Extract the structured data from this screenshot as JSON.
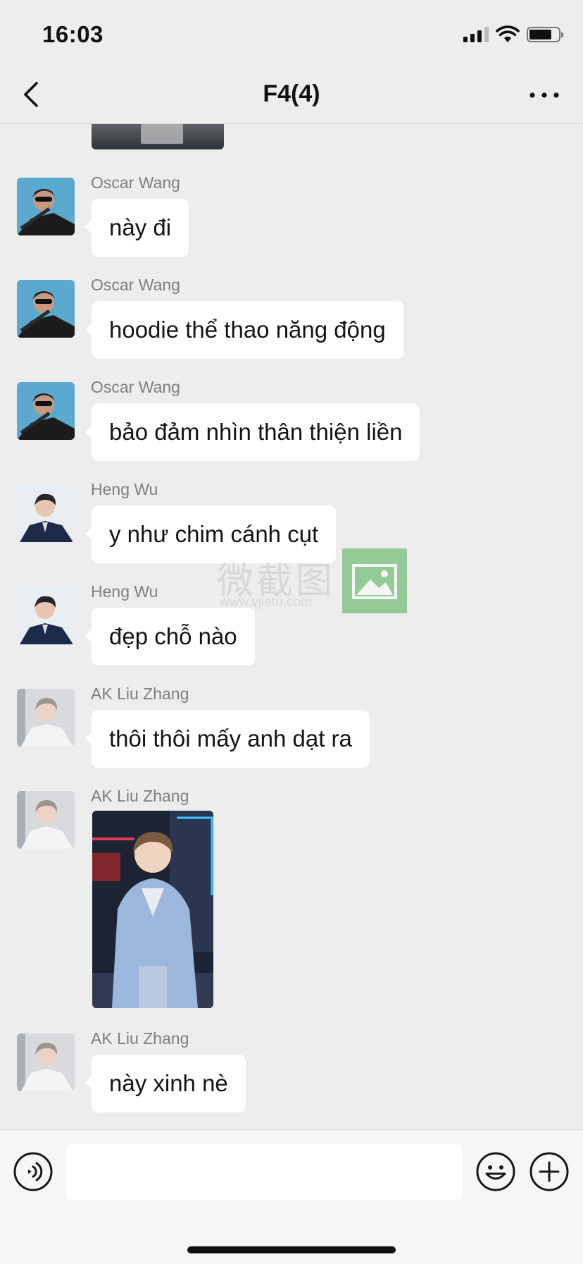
{
  "status_bar": {
    "time": "16:03",
    "icons": [
      "signal-icon",
      "wifi-icon",
      "battery-icon"
    ]
  },
  "nav": {
    "title": "F4(4)",
    "back_icon": "chevron-left-icon",
    "more_icon": "more-dots-icon"
  },
  "messages": [
    {
      "sender": "Oscar Wang",
      "type": "text",
      "text": "này đi",
      "avatar": "oscar"
    },
    {
      "sender": "Oscar Wang",
      "type": "text",
      "text": "hoodie thể thao năng động",
      "avatar": "oscar"
    },
    {
      "sender": "Oscar Wang",
      "type": "text",
      "text": "bảo đảm nhìn thân thiện liền",
      "avatar": "oscar"
    },
    {
      "sender": "Heng Wu",
      "type": "text",
      "text": "y như chim cánh cụt",
      "avatar": "heng"
    },
    {
      "sender": "Heng Wu",
      "type": "text",
      "text": "đẹp chỗ nào",
      "avatar": "heng"
    },
    {
      "sender": "AK Liu Zhang",
      "type": "text",
      "text": "thôi thôi mấy anh dạt ra",
      "avatar": "ak"
    },
    {
      "sender": "AK Liu Zhang",
      "type": "image",
      "avatar": "ak"
    },
    {
      "sender": "AK Liu Zhang",
      "type": "text",
      "text": "này xinh nè",
      "avatar": "ak"
    }
  ],
  "watermark": {
    "text": "微截图",
    "url": "www.vjietu.com"
  },
  "input_bar": {
    "placeholder": "",
    "icons": [
      "voice-icon",
      "emoji-icon",
      "plus-icon"
    ]
  },
  "colors": {
    "background": "#ededed",
    "bubble": "#ffffff",
    "sender_name": "#7f7f7f",
    "watermark_green": "#4caf50"
  }
}
